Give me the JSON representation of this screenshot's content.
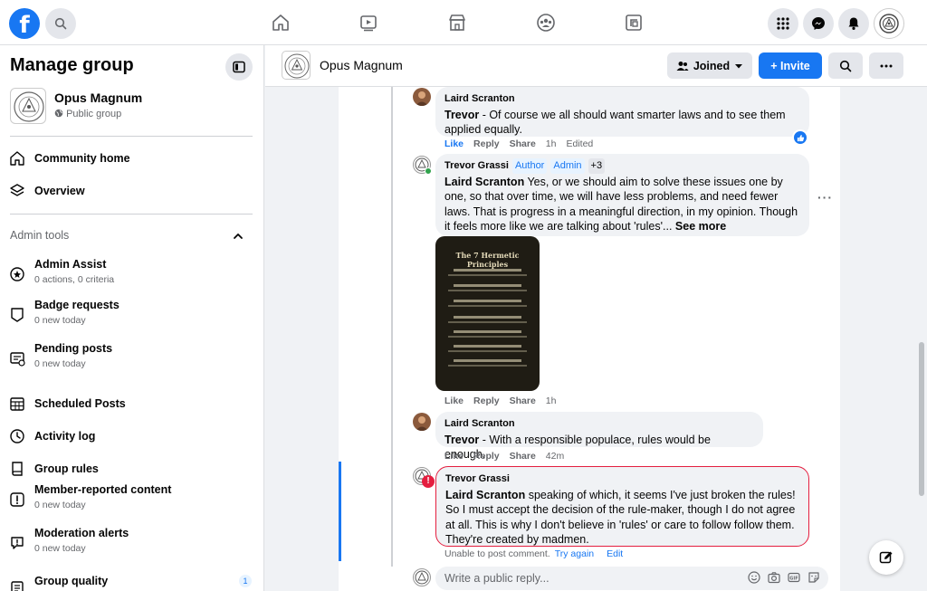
{
  "colors": {
    "brand": "#1877f2",
    "error": "#e41e3f",
    "text_secondary": "#65676b"
  },
  "topbar": {
    "logo": "f",
    "nav_icons": [
      "home-icon",
      "watch-icon",
      "marketplace-icon",
      "groups-icon",
      "gaming-icon"
    ],
    "right_icons": [
      "menu-grid-icon",
      "messenger-icon",
      "notifications-icon",
      "profile-avatar"
    ]
  },
  "sidebar": {
    "title": "Manage group",
    "group_name": "Opus Magnum",
    "group_privacy": "Public group",
    "items": [
      {
        "label": "Community home",
        "icon": "house-icon"
      },
      {
        "label": "Overview",
        "icon": "layers-icon"
      }
    ],
    "admin_tools_label": "Admin tools",
    "admin_items": [
      {
        "label": "Admin Assist",
        "sub": "0 actions, 0 criteria",
        "icon": "admin-assist-icon"
      },
      {
        "label": "Badge requests",
        "sub": "0 new today",
        "icon": "badge-icon"
      },
      {
        "label": "Pending posts",
        "sub": "0 new today",
        "icon": "pending-posts-icon"
      },
      {
        "label": "Scheduled Posts",
        "sub": "",
        "icon": "calendar-icon"
      },
      {
        "label": "Activity log",
        "sub": "",
        "icon": "clock-icon"
      },
      {
        "label": "Group rules",
        "sub": "",
        "icon": "rules-icon"
      },
      {
        "label": "Member-reported content",
        "sub": "0 new today",
        "icon": "report-icon"
      },
      {
        "label": "Moderation alerts",
        "sub": "0 new today",
        "icon": "alert-icon"
      },
      {
        "label": "Group quality",
        "sub": "",
        "icon": "quality-icon",
        "badge": "1"
      }
    ]
  },
  "group_header": {
    "name": "Opus Magnum",
    "joined_label": "Joined",
    "invite_label": "+ Invite"
  },
  "comments": [
    {
      "author": "Laird Scranton",
      "mention": "Trevor",
      "text": " - Of course we all should want smarter laws and to see them applied equally.",
      "actions": {
        "like": "Like",
        "reply": "Reply",
        "share": "Share",
        "time": "1h",
        "edited": "Edited"
      }
    },
    {
      "author": "Trevor Grassi",
      "tags": [
        "Author",
        "Admin",
        "+3"
      ],
      "mention": "Laird Scranton",
      "text": " Yes, or we should aim to solve these issues one by one, so that over time, we will have less problems, and need fewer laws. That is progress in a meaningful direction, in my opinion. Though it feels more like we are talking about 'rules'...",
      "see_more": "See more",
      "image_title": "The 7 Hermetic Principles",
      "actions": {
        "like": "Like",
        "reply": "Reply",
        "share": "Share",
        "time": "1h"
      }
    },
    {
      "author": "Laird Scranton",
      "mention": "Trevor",
      "text": " - With a responsible populace, rules would be enough.",
      "actions": {
        "like": "Like",
        "reply": "Reply",
        "share": "Share",
        "time": "42m"
      }
    },
    {
      "author": "Trevor Grassi",
      "mention": "Laird Scranton",
      "text": " speaking of which, it seems I've just broken the rules! So I must accept the decision of the rule-maker, though I do not agree at all. This is why I don't believe in 'rules' or care to follow follow them. They're created by madmen.",
      "error_text": "Unable to post comment.",
      "try_again": "Try again",
      "edit": "Edit"
    }
  ],
  "reply_box": {
    "placeholder": "Write a public reply..."
  }
}
